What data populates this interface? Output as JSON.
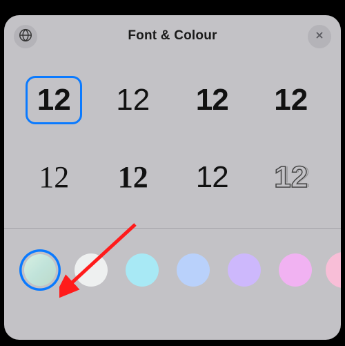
{
  "header": {
    "title": "Font & Colour"
  },
  "fonts": {
    "sample": "12",
    "options": [
      {
        "id": "sf-rounded",
        "selected": true
      },
      {
        "id": "sf-light",
        "selected": false
      },
      {
        "id": "condensed",
        "selected": false
      },
      {
        "id": "stencil",
        "selected": false
      },
      {
        "id": "serif-thin",
        "selected": false
      },
      {
        "id": "serif-bold",
        "selected": false
      },
      {
        "id": "humanist",
        "selected": false
      },
      {
        "id": "outline",
        "selected": false
      }
    ]
  },
  "colors": {
    "options": [
      {
        "id": "pastel-green",
        "hex": "#c7e7d6",
        "selected": true
      },
      {
        "id": "white",
        "hex": "#eef0f0",
        "selected": false
      },
      {
        "id": "cyan",
        "hex": "#a8e9f5",
        "selected": false
      },
      {
        "id": "blue",
        "hex": "#b9d1fb",
        "selected": false
      },
      {
        "id": "purple",
        "hex": "#cdb8fc",
        "selected": false
      },
      {
        "id": "magenta",
        "hex": "#f1b2f2",
        "selected": false
      },
      {
        "id": "pink",
        "hex": "#f8bed7",
        "selected": false
      }
    ]
  },
  "annotation": {
    "arrow_color": "#ff1b1b",
    "points_to": "color-swatch-pastel-green"
  }
}
